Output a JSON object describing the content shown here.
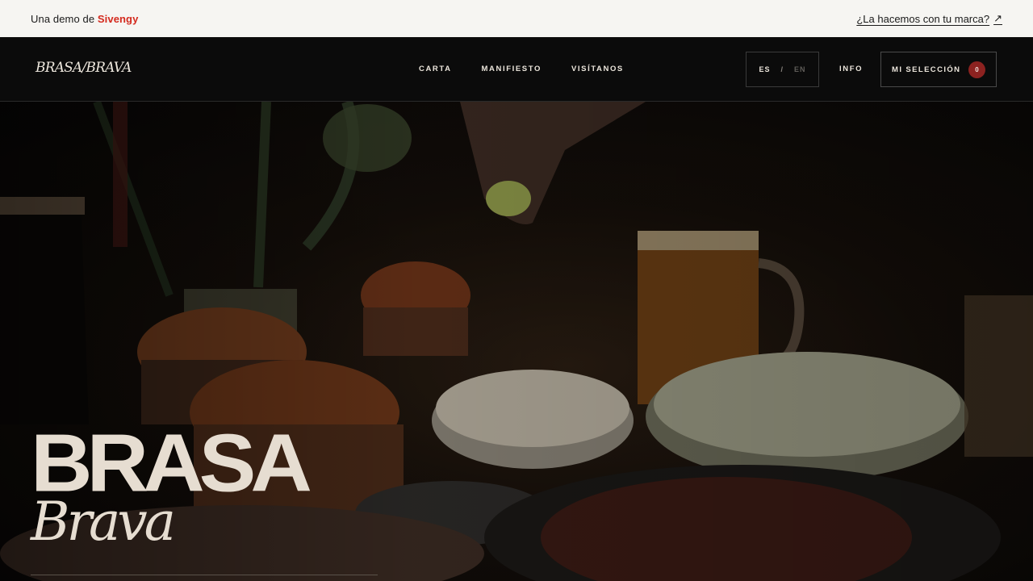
{
  "demo_bar": {
    "prefix": "Una demo de",
    "brand": "Sivengy",
    "cta": "¿La hacemos con tu marca?",
    "cta_icon": "arrow-up-right-icon",
    "background": "#f6f5f2",
    "brand_color": "#d42a1e"
  },
  "nav": {
    "logo": "BRASA/BRAVA",
    "menu": [
      "CARTA",
      "MANIFIESTO",
      "VISÍTANOS"
    ],
    "lang": {
      "active": "ES",
      "separator": "/",
      "inactive": "EN"
    },
    "info": "INFO",
    "selection": {
      "label": "MI SELECCIÓN",
      "count": "0",
      "badge_color": "#8c2220"
    }
  },
  "hero": {
    "title_main": "BRASA",
    "title_sub": "Brava",
    "image": "food-table-photo",
    "text_color": "#e6ddd1"
  }
}
